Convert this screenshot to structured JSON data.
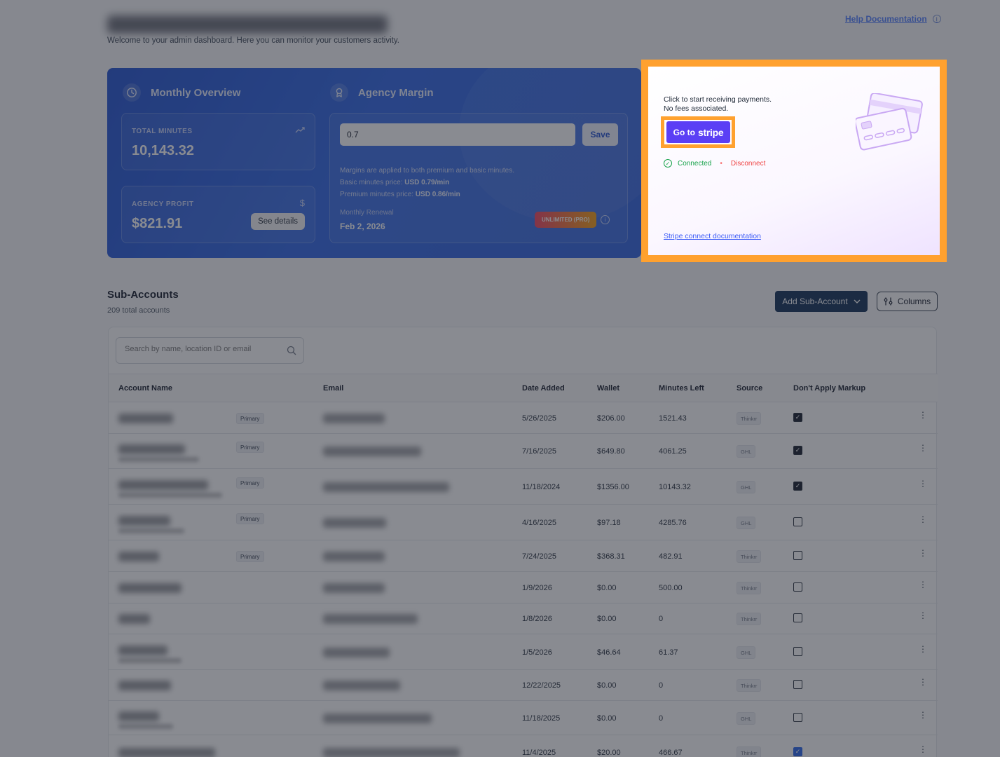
{
  "header": {
    "subtitle": "Welcome to your admin dashboard. Here you can monitor your customers activity.",
    "help_link": "Help Documentation"
  },
  "overview": {
    "monthly_title": "Monthly Overview",
    "margin_title": "Agency Margin",
    "total_minutes_label": "TOTAL MINUTES",
    "total_minutes_value": "10,143.32",
    "agency_profit_label": "AGENCY PROFIT",
    "agency_profit_value": "$821.91",
    "see_details": "See details",
    "margin_value": "0.7",
    "save_label": "Save",
    "note_line1": "Margins are applied to both premium and basic minutes.",
    "note_line2_prefix": "Basic minutes price:",
    "note_line2_value": "USD 0.79/min",
    "note_line3_prefix": "Premium minutes price:",
    "note_line3_value": "USD 0.86/min",
    "renewal_label": "Monthly Renewal",
    "renewal_date": "Feb 2, 2026",
    "plan_badge": "UNLIMITED (PRO)"
  },
  "stripe": {
    "line1": "Click to start receiving payments.",
    "line2": "No fees associated.",
    "button_prefix": "Go to",
    "button_brand": "stripe",
    "connected": "Connected",
    "disconnect": "Disconnect",
    "doc_link": "Stripe connect documentation"
  },
  "subaccounts": {
    "title": "Sub-Accounts",
    "count": "209 total accounts",
    "add_button": "Add Sub-Account",
    "columns_button": "Columns",
    "search_placeholder": "Search by name, location ID or email",
    "columns": [
      "Account Name",
      "Email",
      "Date Added",
      "Wallet",
      "Minutes Left",
      "Source",
      "Don't Apply Markup"
    ],
    "primary_label": "Primary",
    "rows": [
      {
        "date": "5/26/2025",
        "wallet": "$206.00",
        "minutes": "1521.43",
        "source": "Thinkrr",
        "primary": true,
        "markup": true
      },
      {
        "date": "7/16/2025",
        "wallet": "$649.80",
        "minutes": "4061.25",
        "source": "GHL",
        "primary": true,
        "markup": true
      },
      {
        "date": "11/18/2024",
        "wallet": "$1356.00",
        "minutes": "10143.32",
        "source": "GHL",
        "primary": true,
        "markup": true
      },
      {
        "date": "4/16/2025",
        "wallet": "$97.18",
        "minutes": "4285.76",
        "source": "GHL",
        "primary": true,
        "markup": false
      },
      {
        "date": "7/24/2025",
        "wallet": "$368.31",
        "minutes": "482.91",
        "source": "Thinkrr",
        "primary": true,
        "markup": false
      },
      {
        "date": "1/9/2026",
        "wallet": "$0.00",
        "minutes": "500.00",
        "source": "Thinkrr",
        "primary": false,
        "markup": false
      },
      {
        "date": "1/8/2026",
        "wallet": "$0.00",
        "minutes": "0",
        "source": "Thinkrr",
        "primary": false,
        "markup": false
      },
      {
        "date": "1/5/2026",
        "wallet": "$46.64",
        "minutes": "61.37",
        "source": "GHL",
        "primary": false,
        "markup": false
      },
      {
        "date": "12/22/2025",
        "wallet": "$0.00",
        "minutes": "0",
        "source": "Thinkrr",
        "primary": false,
        "markup": false
      },
      {
        "date": "11/18/2025",
        "wallet": "$0.00",
        "minutes": "0",
        "source": "GHL",
        "primary": false,
        "markup": false
      },
      {
        "date": "11/4/2025",
        "wallet": "$20.00",
        "minutes": "466.67",
        "source": "Thinkrr",
        "primary": false,
        "markup": true
      }
    ]
  },
  "colors": {
    "highlight": "#ffa12f",
    "stripe_button": "#5b3ff5",
    "overview_card": "#2a63e6",
    "add_button": "#0c2a52"
  }
}
